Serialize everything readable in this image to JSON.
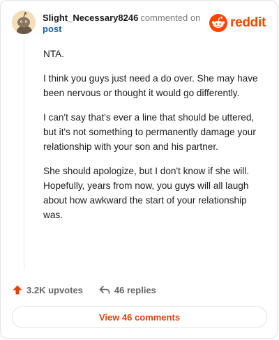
{
  "comment": {
    "username": "Slight_Necessary8246",
    "action_text": "commented on",
    "target_link": "post",
    "brand_name": "reddit",
    "paragraphs": [
      "NTA.",
      "I think you guys just need a do over. She may have been nervous or thought it would go differently.",
      "I can't say that's ever a line that should be uttered, but it's not something to permanently damage your relationship with your son and his partner.",
      "She should apologize, but I don't know if she will. Hopefully, years from now, you guys will all laugh about how awkward the start of your relationship was."
    ],
    "upvotes": "3.2K upvotes",
    "replies": "46 replies",
    "view_comments": "View 46 comments"
  },
  "colors": {
    "brand": "#ff4500",
    "link": "#1a5fa8",
    "upvote": "#e0430b"
  },
  "icons": {
    "avatar": "snoo-avatar-icon",
    "brand_logo": "reddit-logo-icon",
    "upvote": "upvote-arrow-icon",
    "reply": "reply-arrow-icon"
  }
}
